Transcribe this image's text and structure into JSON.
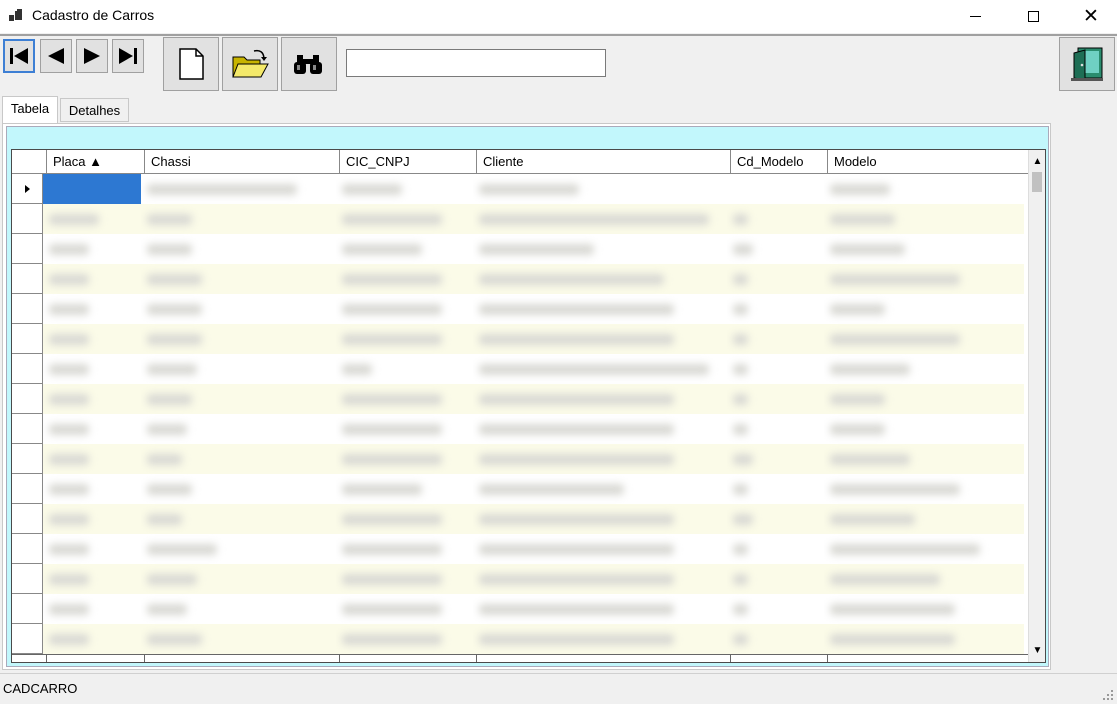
{
  "window": {
    "title": "Cadastro de Carros",
    "controls": [
      "minimize",
      "maximize",
      "close"
    ]
  },
  "toolbar": {
    "nav_buttons": [
      "first-record",
      "previous-record",
      "next-record",
      "last-record"
    ],
    "action_buttons": [
      "new-document-icon",
      "open-folder-icon",
      "binoculars-icon"
    ],
    "search": {
      "value": "",
      "placeholder": ""
    },
    "exit_button": "exit-door-icon"
  },
  "tabs": [
    {
      "label": "Tabela",
      "active": true
    },
    {
      "label": "Detalhes",
      "active": false
    }
  ],
  "grid": {
    "columns": [
      {
        "label": "Placa ▲"
      },
      {
        "label": "Chassi"
      },
      {
        "label": "CIC_CNPJ"
      },
      {
        "label": "Cliente"
      },
      {
        "label": "Cd_Modelo"
      },
      {
        "label": "Modelo"
      }
    ],
    "selected_row": 0,
    "row_count_visible": 16,
    "colors": {
      "selection": "#2d78d2",
      "alt_row": "#fbfbe8",
      "panel_bg": "#c2f7fc"
    }
  },
  "status": {
    "text": "CADCARRO"
  }
}
